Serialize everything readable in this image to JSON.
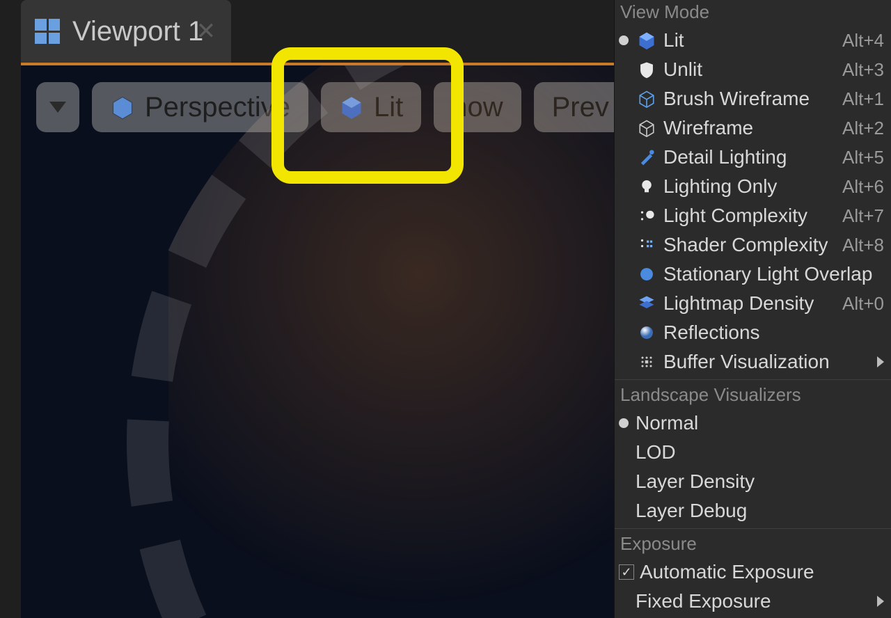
{
  "tab": {
    "title": "Viewport 1"
  },
  "toolbar": {
    "perspective": "Perspective",
    "lit": "Lit",
    "show": "how",
    "preview": "Prev"
  },
  "menu": {
    "section_view_mode": "View Mode",
    "items": [
      {
        "label": "Lit",
        "shortcut": "Alt+4",
        "icon": "cube-blue",
        "radio": true
      },
      {
        "label": "Unlit",
        "shortcut": "Alt+3",
        "icon": "shield-white"
      },
      {
        "label": "Brush Wireframe",
        "shortcut": "Alt+1",
        "icon": "cube-wire-blue"
      },
      {
        "label": "Wireframe",
        "shortcut": "Alt+2",
        "icon": "cube-wire"
      },
      {
        "label": "Detail Lighting",
        "shortcut": "Alt+5",
        "icon": "brush-blue"
      },
      {
        "label": "Lighting Only",
        "shortcut": "Alt+6",
        "icon": "bulb-white"
      },
      {
        "label": "Light Complexity",
        "shortcut": "Alt+7",
        "icon": "dots-star"
      },
      {
        "label": "Shader Complexity",
        "shortcut": "Alt+8",
        "icon": "dots-grid"
      },
      {
        "label": "Stationary Light Overlap",
        "shortcut": "",
        "icon": "sphere-blue"
      },
      {
        "label": "Lightmap Density",
        "shortcut": "Alt+0",
        "icon": "layers-blue"
      },
      {
        "label": "Reflections",
        "shortcut": "",
        "icon": "sphere-grad"
      },
      {
        "label": "Buffer Visualization",
        "shortcut": "",
        "icon": "grid-dots",
        "submenu": true
      }
    ],
    "section_landscape": "Landscape Visualizers",
    "landscape_items": [
      {
        "label": "Normal",
        "radio": true
      },
      {
        "label": "LOD"
      },
      {
        "label": "Layer Density"
      },
      {
        "label": "Layer Debug"
      }
    ],
    "section_exposure": "Exposure",
    "exposure_auto": "Automatic Exposure",
    "exposure_fixed": "Fixed Exposure"
  }
}
